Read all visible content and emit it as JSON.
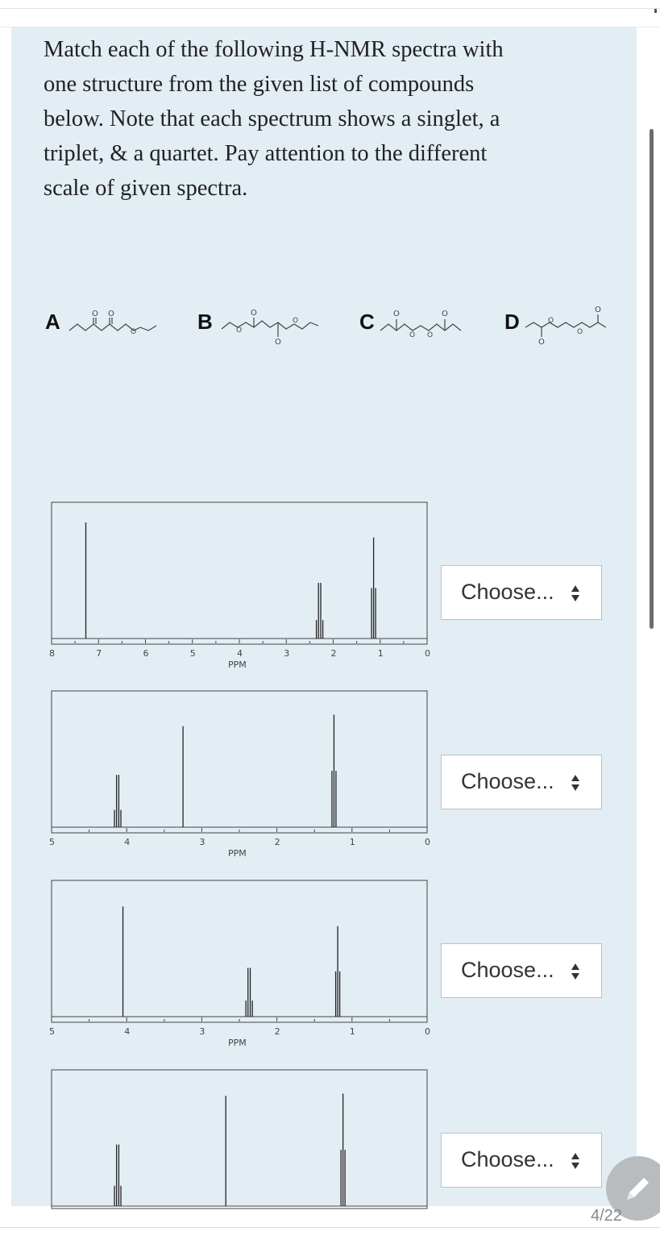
{
  "question": {
    "lines": [
      "Match each of the following H-NMR spectra with",
      "one structure from the given list of compounds",
      "below. Note that each spectrum shows a singlet, a",
      "triplet, & a quartet. Pay attention to the different",
      "scale of given spectra."
    ]
  },
  "compounds": [
    {
      "letter": "A"
    },
    {
      "letter": "B"
    },
    {
      "letter": "C"
    },
    {
      "letter": "D"
    }
  ],
  "spectra": [
    {
      "xlabel": "PPM",
      "ticks": [
        "8",
        "7",
        "6",
        "5",
        "4",
        "3",
        "2",
        "1",
        "0"
      ],
      "chart_data": {
        "type": "line",
        "xlim": [
          8,
          0
        ],
        "peaks": [
          {
            "ppm": 7.27,
            "height": 1.0,
            "mult": "singlet"
          },
          {
            "ppm": 2.29,
            "height": 0.48,
            "mult": "quartet"
          },
          {
            "ppm": 1.14,
            "height": 0.87,
            "mult": "triplet"
          }
        ]
      }
    },
    {
      "xlabel": "PPM",
      "ticks": [
        "5",
        "4",
        "3",
        "2",
        "1",
        "0"
      ],
      "chart_data": {
        "type": "line",
        "xlim": [
          5,
          0
        ],
        "peaks": [
          {
            "ppm": 4.12,
            "height": 0.45,
            "mult": "quartet"
          },
          {
            "ppm": 3.25,
            "height": 0.87,
            "mult": "singlet"
          },
          {
            "ppm": 1.24,
            "height": 0.97,
            "mult": "triplet"
          }
        ]
      }
    },
    {
      "xlabel": "PPM",
      "ticks": [
        "5",
        "4",
        "3",
        "2",
        "1",
        "0"
      ],
      "chart_data": {
        "type": "line",
        "xlim": [
          5,
          0
        ],
        "peaks": [
          {
            "ppm": 4.05,
            "height": 0.95,
            "mult": "singlet"
          },
          {
            "ppm": 2.37,
            "height": 0.42,
            "mult": "quartet"
          },
          {
            "ppm": 1.19,
            "height": 0.78,
            "mult": "triplet"
          }
        ]
      }
    },
    {
      "xlabel": "",
      "ticks": [],
      "chart_data": {
        "type": "line",
        "xlim": [
          5,
          0
        ],
        "peaks": [
          {
            "ppm": 4.12,
            "height": 0.53,
            "mult": "quartet"
          },
          {
            "ppm": 2.68,
            "height": 0.95,
            "mult": "singlet"
          },
          {
            "ppm": 1.12,
            "height": 0.97,
            "mult": "triplet"
          }
        ]
      }
    }
  ],
  "selects": [
    {
      "label": "Choose..."
    },
    {
      "label": "Choose..."
    },
    {
      "label": "Choose..."
    },
    {
      "label": "Choose..."
    }
  ],
  "footer": {
    "page_indicator": "4/22"
  }
}
